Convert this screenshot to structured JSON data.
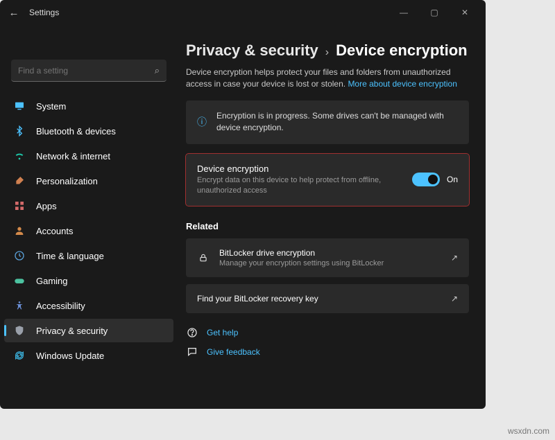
{
  "window": {
    "title": "Settings"
  },
  "search": {
    "placeholder": "Find a setting"
  },
  "sidebar": {
    "items": [
      {
        "label": "System",
        "icon": "display-icon",
        "color": "#4cc2ff"
      },
      {
        "label": "Bluetooth & devices",
        "icon": "bluetooth-icon",
        "color": "#4cc2ff"
      },
      {
        "label": "Network & internet",
        "icon": "wifi-icon",
        "color": "#1cc7a8"
      },
      {
        "label": "Personalization",
        "icon": "brush-icon",
        "color": "#d08050"
      },
      {
        "label": "Apps",
        "icon": "apps-icon",
        "color": "#d46a6a"
      },
      {
        "label": "Accounts",
        "icon": "person-icon",
        "color": "#d48a4a"
      },
      {
        "label": "Time & language",
        "icon": "clock-icon",
        "color": "#5aa0d8"
      },
      {
        "label": "Gaming",
        "icon": "gaming-icon",
        "color": "#4cc2a0"
      },
      {
        "label": "Accessibility",
        "icon": "accessibility-icon",
        "color": "#6a8ed4"
      },
      {
        "label": "Privacy & security",
        "icon": "shield-icon",
        "color": "#9aa0aa",
        "active": true
      },
      {
        "label": "Windows Update",
        "icon": "update-icon",
        "color": "#3aaed8"
      }
    ]
  },
  "breadcrumb": {
    "parent": "Privacy & security",
    "current": "Device encryption"
  },
  "description": {
    "text": "Device encryption helps protect your files and folders from unauthorized access in case your device is lost or stolen. ",
    "link": "More about device encryption"
  },
  "info_card": {
    "text": "Encryption is in progress. Some drives can't be managed with device encryption."
  },
  "toggle_card": {
    "title": "Device encryption",
    "subtitle": "Encrypt data on this device to help protect from offline, unauthorized access",
    "state_label": "On",
    "state": true
  },
  "related": {
    "label": "Related",
    "items": [
      {
        "title": "BitLocker drive encryption",
        "subtitle": "Manage your encryption settings using BitLocker",
        "icon": "lock-icon"
      },
      {
        "title": "Find your BitLocker recovery key",
        "subtitle": "",
        "icon": ""
      }
    ]
  },
  "footer": {
    "help": "Get help",
    "feedback": "Give feedback"
  },
  "watermark": "wsxdn.com",
  "colors": {
    "accent": "#4cc2ff",
    "bg": "#1a1a1a",
    "card": "#2a2a2a",
    "highlight": "#a03030"
  }
}
